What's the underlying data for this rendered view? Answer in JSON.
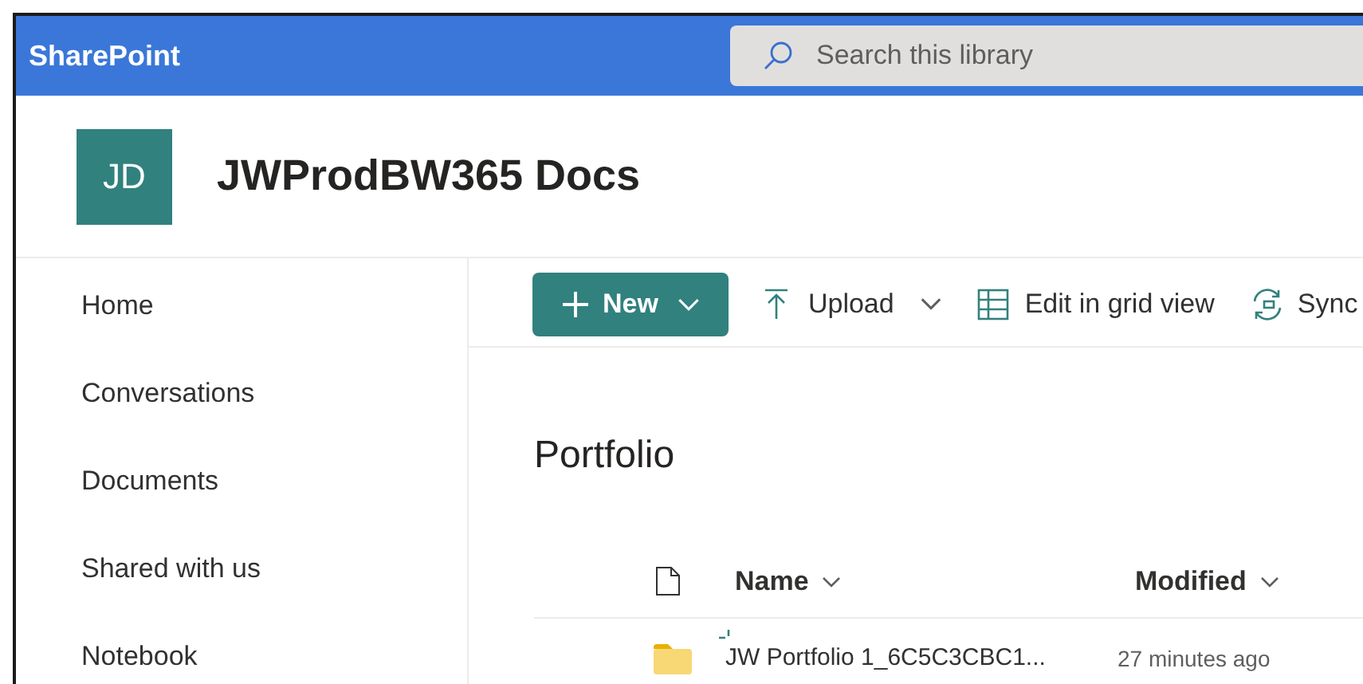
{
  "app_bar": {
    "brand": "SharePoint",
    "search": {
      "placeholder": "Search this library"
    }
  },
  "site": {
    "initials": "JD",
    "title": "JWProdBW365 Docs"
  },
  "nav": [
    {
      "label": "Home"
    },
    {
      "label": "Conversations"
    },
    {
      "label": "Documents"
    },
    {
      "label": "Shared with us"
    },
    {
      "label": "Notebook"
    }
  ],
  "commands": [
    {
      "kind": "new",
      "label": "New"
    },
    {
      "kind": "upload",
      "label": "Upload"
    },
    {
      "kind": "grid",
      "label": "Edit in grid view"
    },
    {
      "kind": "sync",
      "label": "Sync"
    }
  ],
  "library": {
    "title": "Portfolio",
    "columns": [
      "Name",
      "Modified"
    ],
    "rows": [
      {
        "name": "JW Portfolio 1_6C5C3CBC1...",
        "modified": "27 minutes ago",
        "new": true
      }
    ]
  }
}
